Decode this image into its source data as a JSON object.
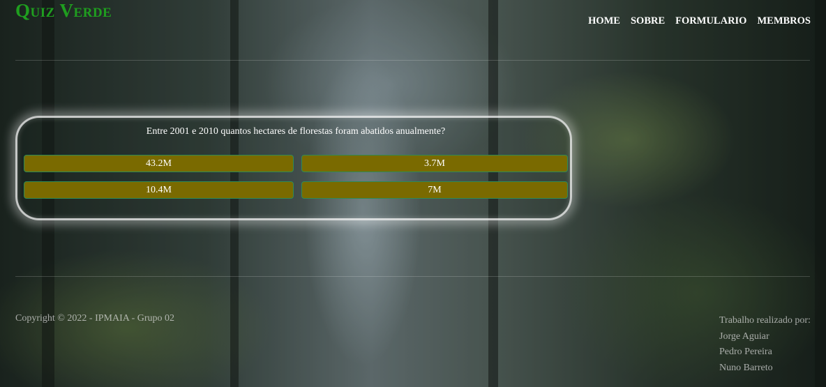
{
  "header": {
    "logo": "Quiz Verde",
    "nav": [
      "HOME",
      "SOBRE",
      "FORMULARIO",
      "MEMBROS"
    ]
  },
  "quiz": {
    "question": "Entre 2001 e 2010 quantos hectares de florestas foram abatidos anualmente?",
    "answers": [
      "43.2M",
      "3.7M",
      "10.4M",
      "7M"
    ]
  },
  "footer": {
    "copyright": "Copyright © 2022 - IPMAIA - Grupo 02",
    "credits_title": "Trabalho realizado por:",
    "members": [
      "Jorge Aguiar",
      "Pedro Pereira",
      "Nuno Barreto"
    ]
  },
  "colors": {
    "logo": "#1f9e1f",
    "answer_bg": "#7a6a00",
    "answer_border": "#2e8b57"
  }
}
